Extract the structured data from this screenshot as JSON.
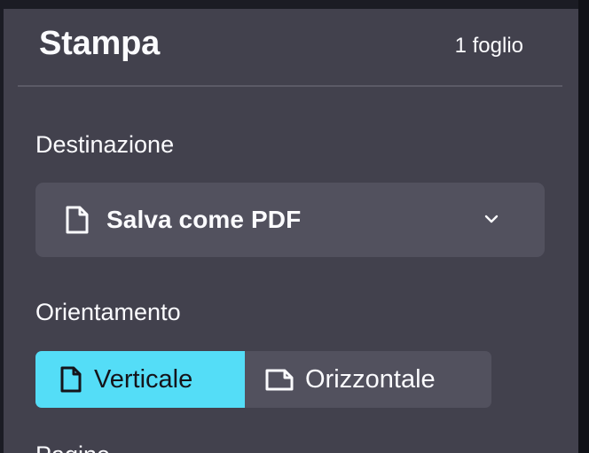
{
  "print_panel": {
    "title": "Stampa",
    "sheet_count": "1 foglio",
    "destination": {
      "label": "Destinazione",
      "selected": "Salva come PDF",
      "icon": "document-icon"
    },
    "orientation": {
      "label": "Orientamento",
      "options": [
        {
          "label": "Verticale",
          "icon": "portrait-page-icon",
          "selected": true
        },
        {
          "label": "Orizzontale",
          "icon": "landscape-page-icon",
          "selected": false
        }
      ]
    },
    "next_section_label": "Pagine"
  },
  "colors": {
    "panel_bg": "#42414d",
    "control_bg": "#52515e",
    "accent": "#54ddf7",
    "text": "#fbfbfe"
  }
}
